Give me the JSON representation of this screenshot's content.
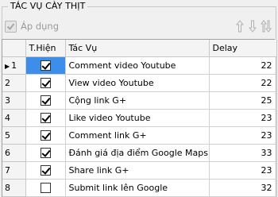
{
  "group": {
    "title": "TÁC VỤ CÀY THỊT"
  },
  "toolbar": {
    "apply_label": "Áp dụng",
    "buttons": [
      "arrow-up-icon",
      "arrow-down-icon",
      "reorder-icon"
    ]
  },
  "grid": {
    "columns": [
      "",
      "T.Hiện",
      "Tác Vụ",
      "Delay"
    ],
    "current_row_marker": "▶",
    "rows": [
      {
        "index": "1",
        "enabled": true,
        "task": "Comment video Youtube",
        "delay": "22"
      },
      {
        "index": "2",
        "enabled": true,
        "task": "View video Youtube",
        "delay": "22"
      },
      {
        "index": "3",
        "enabled": true,
        "task": "Cộng link G+",
        "delay": "25"
      },
      {
        "index": "4",
        "enabled": true,
        "task": "Like video Youtube",
        "delay": "23"
      },
      {
        "index": "5",
        "enabled": true,
        "task": "Comment link G+",
        "delay": "23"
      },
      {
        "index": "6",
        "enabled": true,
        "task": "Đánh giá địa điểm Google Maps",
        "delay": "33"
      },
      {
        "index": "7",
        "enabled": true,
        "task": "Share link G+",
        "delay": "23"
      },
      {
        "index": "8",
        "enabled": false,
        "task": "Submit link lên Google",
        "delay": "32"
      }
    ]
  },
  "colors": {
    "selection": "#3d8eea",
    "disabled_text": "#9a9a9a"
  }
}
